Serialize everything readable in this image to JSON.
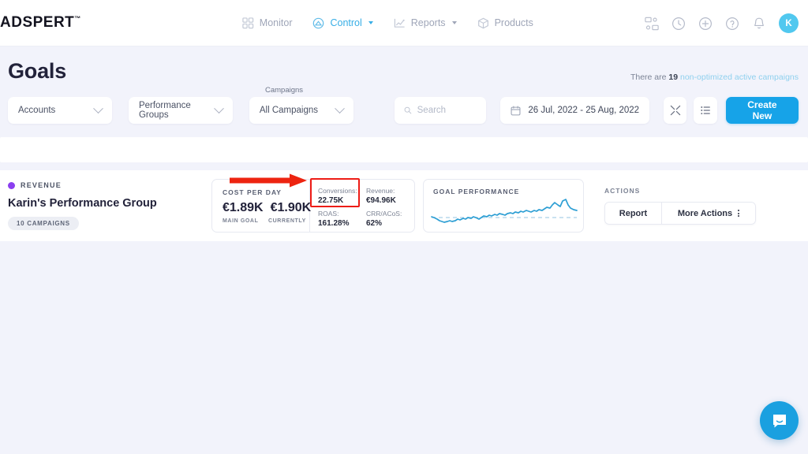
{
  "brand": {
    "name": "ADSPERT",
    "tm": "™"
  },
  "nav": {
    "items": [
      {
        "label": "Monitor",
        "icon": "grid-icon",
        "active": false,
        "caret": false
      },
      {
        "label": "Control",
        "icon": "gauge-icon",
        "active": true,
        "caret": true
      },
      {
        "label": "Reports",
        "icon": "chart-icon",
        "active": false,
        "caret": true
      },
      {
        "label": "Products",
        "icon": "box-icon",
        "active": false,
        "caret": false
      }
    ],
    "right_icons": [
      "contacts-icon",
      "history-icon",
      "plus-circle-icon",
      "help-circle-icon",
      "bell-icon"
    ],
    "avatar_initial": "K"
  },
  "page": {
    "title": "Goals",
    "notice_prefix": "There are",
    "notice_count": "19",
    "notice_link": "non-optimized active campaigns"
  },
  "filters": {
    "accounts": "Accounts",
    "performance_groups": "Performance Groups",
    "campaigns_label": "Campaigns",
    "campaigns_value": "All Campaigns",
    "search_placeholder": "Search",
    "search_value": "",
    "date_range": "26 Jul, 2022 - 25 Aug, 2022",
    "collapse_icon": "collapse-icon",
    "list_icon": "list-view-icon",
    "create_new": "Create New"
  },
  "goal_card": {
    "type_label": "REVENUE",
    "type_color": "#8b3ff0",
    "group_name": "Karin's Performance Group",
    "campaigns_badge": "10 CAMPAIGNS",
    "cost_per_day": {
      "title": "COST PER DAY",
      "main_goal_value": "€1.89K",
      "currently_value": "€1.90K",
      "main_goal_label": "MAIN GOAL",
      "currently_label": "CURRENTLY"
    },
    "metrics": [
      {
        "label": "Conversions:",
        "value": "22.75K",
        "highlighted": true
      },
      {
        "label": "Revenue:",
        "value": "€94.96K",
        "highlighted": false
      },
      {
        "label": "ROAS:",
        "value": "161.28%",
        "highlighted": false
      },
      {
        "label": "CRR/ACoS:",
        "value": "62%",
        "highlighted": false
      }
    ],
    "highlight_color": "#ed1c16",
    "performance": {
      "title": "GOAL PERFORMANCE"
    },
    "actions": {
      "title": "ACTIONS",
      "report": "Report",
      "more_actions": "More Actions"
    }
  },
  "chart_data": {
    "type": "line",
    "title": "GOAL PERFORMANCE",
    "xlabel": "",
    "ylabel": "",
    "grid": false,
    "legend": "none",
    "series": [
      {
        "name": "Goal performance",
        "color": "#2e9fd4",
        "values": [
          34,
          33,
          31,
          29,
          27,
          26,
          27,
          28,
          27,
          28,
          30,
          29,
          31,
          30,
          32,
          31,
          33,
          32,
          30,
          32,
          34,
          33,
          35,
          34,
          36,
          35,
          37,
          36,
          35,
          37,
          38,
          37,
          39,
          38,
          40,
          39,
          41,
          40,
          39,
          41,
          40,
          42,
          41,
          43,
          45,
          44,
          48,
          52,
          49,
          47,
          55,
          60,
          52,
          47,
          44,
          42
        ]
      },
      {
        "name": "Target",
        "color": "#b9d9ec",
        "style": "dashed",
        "constant": 36
      }
    ],
    "ylim": [
      20,
      65
    ]
  },
  "chat": {
    "icon": "chat-bubble-icon"
  }
}
